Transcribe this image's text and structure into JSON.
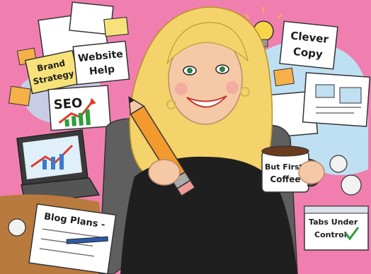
{
  "labels": {
    "brand_line1": "Brand",
    "brand_line2": "Strategy",
    "website_line1": "Website",
    "website_line2": "Help",
    "seo": "SEO",
    "clever_line1": "Clever",
    "clever_line2": "Copy",
    "mug_line1": "But First,",
    "mug_line2": "Coffee",
    "blog": "Blog Plans -",
    "tabs_line1": "Tabs Under",
    "tabs_line2": "Control"
  },
  "icons": [
    "lightbulb-icon",
    "checkmark-icon",
    "trend-arrow-icon",
    "pencil-icon"
  ],
  "colors": {
    "background": "#f07fb0",
    "note_yellow": "#f7e27a",
    "note_orange": "#f6b04a",
    "sky": "#bfe0f2",
    "hair": "#f3d36a",
    "sweater": "#1f1f1f",
    "laptop": "#3a3a3a",
    "chair": "#5f5f5f",
    "pencil": "#f29a2e",
    "check": "#2e9e3a",
    "trend_red": "#e23a2a"
  }
}
